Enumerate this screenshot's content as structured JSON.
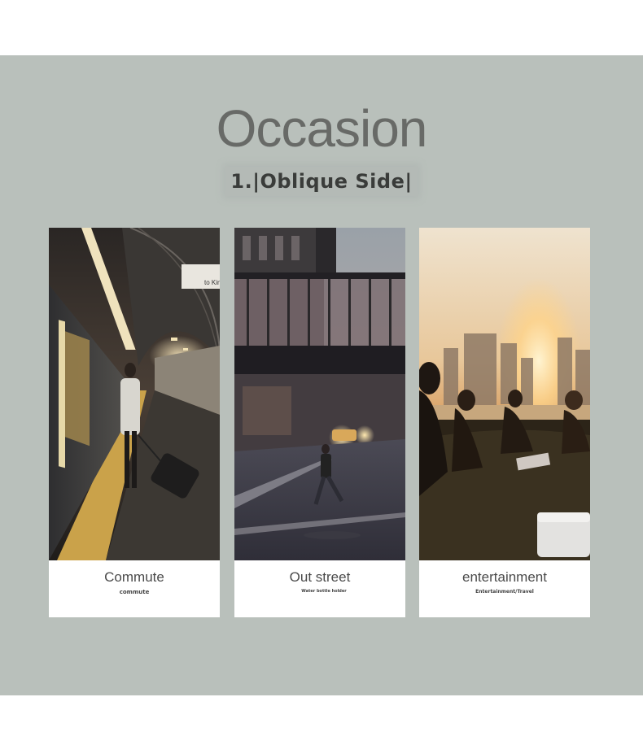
{
  "title": "Occasion",
  "subtitle": "1.|Oblique Side|",
  "cards": [
    {
      "label": "Commute",
      "sub": "commute",
      "sign": "to Kin"
    },
    {
      "label": "Out street",
      "sub": "Water bottle holder"
    },
    {
      "label": "entertainment",
      "sub": "Entertainment/Travel"
    }
  ],
  "colors": {
    "panel": "#b9c0bb",
    "title": "#686a67",
    "subtitle": "#3a3c3a"
  }
}
